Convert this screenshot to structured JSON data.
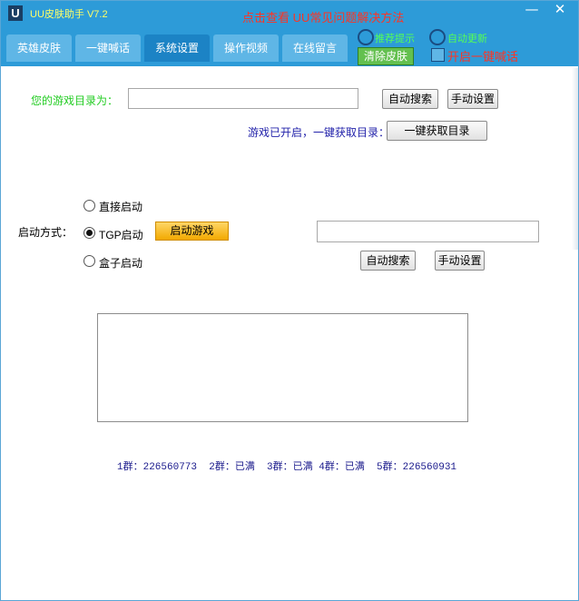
{
  "app": {
    "logo_letter": "U",
    "title": "UU皮肤助手 V7.2",
    "notice": "点击查看 UU常见问题解决方法"
  },
  "window_controls": {
    "minimize": "—",
    "close": "✕"
  },
  "tabs": [
    {
      "label": "英雄皮肤"
    },
    {
      "label": "一键喊话"
    },
    {
      "label": "系统设置",
      "active": true
    },
    {
      "label": "操作视频"
    },
    {
      "label": "在线留言"
    }
  ],
  "header_options": {
    "radio1_label": "推荐提示",
    "radio2_label": "自动更新",
    "clear_skin_label": "清除皮肤",
    "one_key_shout_label": "开启一键喊话"
  },
  "settings": {
    "game_dir_label": "您的游戏目录为：",
    "game_dir_value": "",
    "auto_search_label": "自动搜索",
    "manual_set_label": "手动设置",
    "onekey_hint": "游戏已开启，一键获取目录：",
    "onekey_button": "一键获取目录",
    "start_mode_label": "启动方式：",
    "start_options": [
      {
        "label": "直接启动",
        "checked": false
      },
      {
        "label": "TGP启动",
        "checked": true
      },
      {
        "label": "盒子启动",
        "checked": false
      }
    ],
    "launch_button": "启动游戏",
    "tgp_path_value": "",
    "auto_search_label2": "自动搜索",
    "manual_set_label2": "手动设置"
  },
  "groups_text": "1群：226560773  2群：已满  3群：已满 4群：已满  5群：226560931",
  "colors": {
    "titlebar": "#2d9bd8",
    "tab_active": "#1c83c5",
    "notice_red": "#ff3322",
    "dir_label_green": "#22cc22"
  },
  "icons": [
    "app-logo-icon",
    "minimize-icon",
    "close-icon"
  ]
}
